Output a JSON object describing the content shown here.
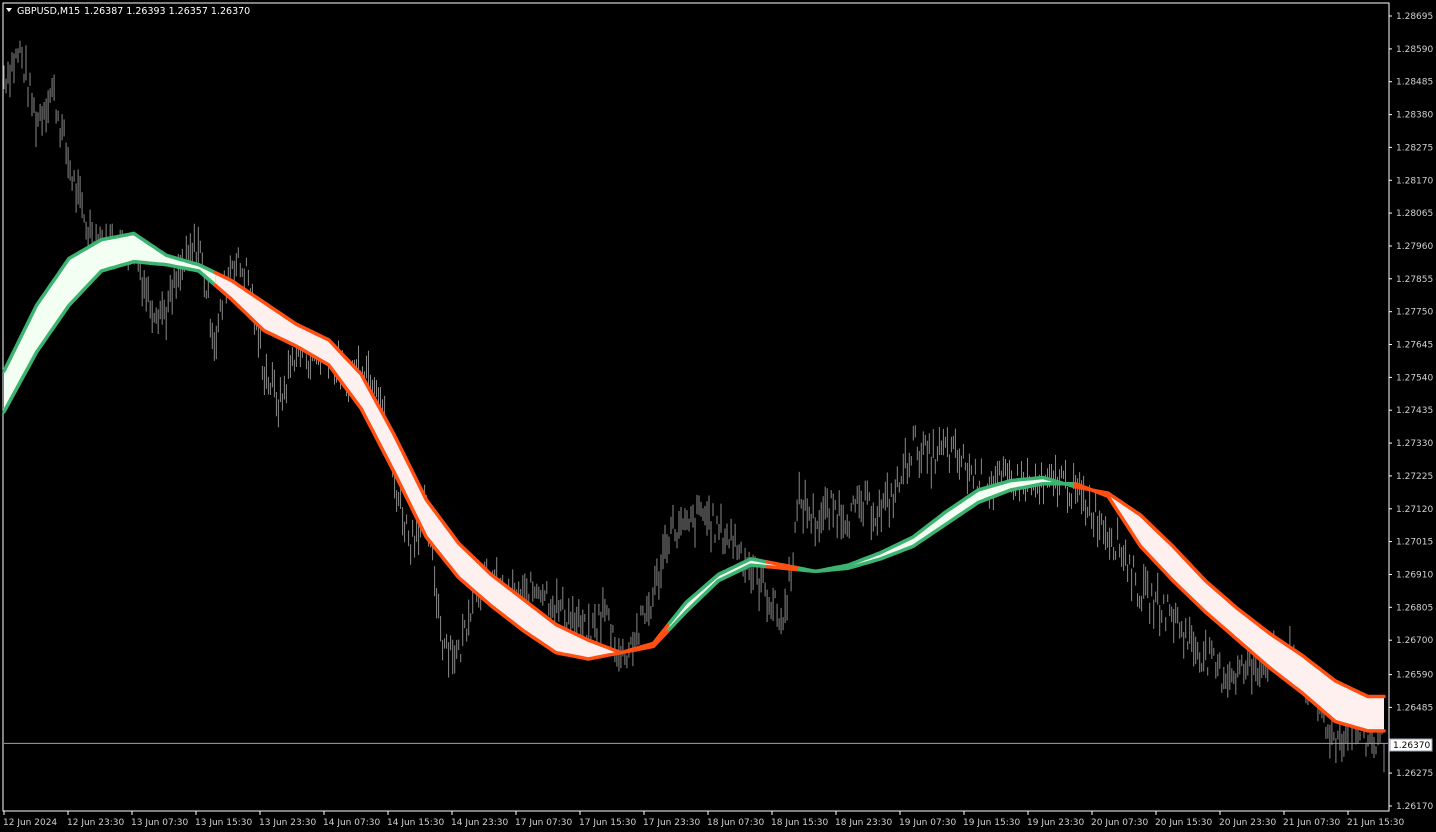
{
  "header": {
    "symbol": "GBPUSD,M15",
    "quote": "1.26387 1.26393 1.26357 1.26370"
  },
  "current_price_label": "1.26370",
  "colors": {
    "background": "#000000",
    "frame": "#ffffff",
    "candles": "#8a8a8a",
    "bull_band_line": "#3cb371",
    "bull_band_fill": "#f3fff3",
    "bear_band_line": "#ff4f12",
    "bear_band_fill": "#fff0f0",
    "price_line": "#9aa4b0"
  },
  "chart_data": {
    "type": "line",
    "symbol": "GBPUSD",
    "timeframe": "M15",
    "ylim": [
      1.2617,
      1.28695
    ],
    "y_ticks": [
      "1.28695",
      "1.28590",
      "1.28485",
      "1.28380",
      "1.28275",
      "1.28170",
      "1.28065",
      "1.27960",
      "1.27855",
      "1.27750",
      "1.27645",
      "1.27540",
      "1.27435",
      "1.27330",
      "1.27225",
      "1.27120",
      "1.27015",
      "1.26910",
      "1.26805",
      "1.26700",
      "1.26590",
      "1.26485",
      "1.26275",
      "1.26170"
    ],
    "x_ticks": [
      "12 Jun 2024",
      "12 Jun 23:30",
      "13 Jun 07:30",
      "13 Jun 15:30",
      "13 Jun 23:30",
      "14 Jun 07:30",
      "14 Jun 15:30",
      "14 Jun 23:30",
      "17 Jun 07:30",
      "17 Jun 15:30",
      "17 Jun 23:30",
      "18 Jun 07:30",
      "18 Jun 15:30",
      "18 Jun 23:30",
      "19 Jun 07:30",
      "19 Jun 15:30",
      "19 Jun 23:30",
      "20 Jun 07:30",
      "20 Jun 15:30",
      "20 Jun 23:30",
      "21 Jun 07:30",
      "21 Jun 15:30"
    ],
    "current_price": 1.2637,
    "price_close_path": [
      [
        0,
        1.285
      ],
      [
        1,
        1.2858
      ],
      [
        2,
        1.2836
      ],
      [
        3,
        1.2846
      ],
      [
        4,
        1.2822
      ],
      [
        5,
        1.2803
      ],
      [
        6,
        1.2797
      ],
      [
        7,
        1.2796
      ],
      [
        8,
        1.2795
      ],
      [
        9,
        1.2778
      ],
      [
        10,
        1.2775
      ],
      [
        11,
        1.2789
      ],
      [
        12,
        1.2797
      ],
      [
        13,
        1.2765
      ],
      [
        14,
        1.2792
      ],
      [
        15,
        1.2787
      ],
      [
        16,
        1.2757
      ],
      [
        17,
        1.2745
      ],
      [
        18,
        1.2764
      ],
      [
        19,
        1.276
      ],
      [
        20,
        1.2762
      ],
      [
        21,
        1.2752
      ],
      [
        22,
        1.2759
      ],
      [
        23,
        1.2754
      ],
      [
        24,
        1.2722
      ],
      [
        25,
        1.2702
      ],
      [
        26,
        1.2711
      ],
      [
        27,
        1.2671
      ],
      [
        28,
        1.2665
      ],
      [
        29,
        1.2688
      ],
      [
        30,
        1.2688
      ],
      [
        31,
        1.2684
      ],
      [
        32,
        1.2683
      ],
      [
        33,
        1.2688
      ],
      [
        34,
        1.2681
      ],
      [
        35,
        1.2677
      ],
      [
        36,
        1.2671
      ],
      [
        37,
        1.268
      ],
      [
        38,
        1.2664
      ],
      [
        39,
        1.2672
      ],
      [
        40,
        1.2684
      ],
      [
        41,
        1.2706
      ],
      [
        42,
        1.2705
      ],
      [
        43,
        1.2711
      ],
      [
        44,
        1.2705
      ],
      [
        45,
        1.2702
      ],
      [
        46,
        1.2693
      ],
      [
        47,
        1.2685
      ],
      [
        48,
        1.2675
      ],
      [
        49,
        1.2715
      ],
      [
        50,
        1.2708
      ],
      [
        51,
        1.2712
      ],
      [
        52,
        1.271
      ],
      [
        53,
        1.2713
      ],
      [
        54,
        1.2711
      ],
      [
        55,
        1.2718
      ],
      [
        56,
        1.2733
      ],
      [
        57,
        1.2728
      ],
      [
        58,
        1.2731
      ],
      [
        59,
        1.2727
      ],
      [
        60,
        1.2721
      ],
      [
        61,
        1.272
      ],
      [
        62,
        1.2721
      ],
      [
        63,
        1.272
      ],
      [
        64,
        1.2718
      ],
      [
        65,
        1.2722
      ],
      [
        66,
        1.2717
      ],
      [
        67,
        1.2712
      ],
      [
        68,
        1.2705
      ],
      [
        69,
        1.2698
      ],
      [
        70,
        1.2685
      ],
      [
        71,
        1.2682
      ],
      [
        72,
        1.2678
      ],
      [
        73,
        1.267
      ],
      [
        74,
        1.2665
      ],
      [
        75,
        1.2659
      ],
      [
        76,
        1.266
      ],
      [
        77,
        1.2662
      ],
      [
        78,
        1.2664
      ],
      [
        79,
        1.2665
      ],
      [
        80,
        1.2661
      ],
      [
        81,
        1.2648
      ],
      [
        82,
        1.2638
      ],
      [
        83,
        1.2643
      ],
      [
        84,
        1.2638
      ],
      [
        85,
        1.2637
      ]
    ],
    "band_upper": [
      [
        0,
        1.2756
      ],
      [
        2,
        1.2777
      ],
      [
        4,
        1.2792
      ],
      [
        6,
        1.2798
      ],
      [
        8,
        1.28
      ],
      [
        10,
        1.2793
      ],
      [
        12,
        1.279
      ],
      [
        14,
        1.2785
      ],
      [
        16,
        1.2778
      ],
      [
        18,
        1.2771
      ],
      [
        20,
        1.2766
      ],
      [
        22,
        1.2755
      ],
      [
        24,
        1.2736
      ],
      [
        26,
        1.2715
      ],
      [
        28,
        1.2701
      ],
      [
        30,
        1.2691
      ],
      [
        32,
        1.2683
      ],
      [
        34,
        1.2675
      ],
      [
        36,
        1.267
      ],
      [
        38,
        1.2666
      ],
      [
        40,
        1.2669
      ],
      [
        42,
        1.2682
      ],
      [
        44,
        1.2691
      ],
      [
        46,
        1.2696
      ],
      [
        48,
        1.2694
      ],
      [
        50,
        1.2692
      ],
      [
        52,
        1.2694
      ],
      [
        54,
        1.2698
      ],
      [
        56,
        1.2703
      ],
      [
        58,
        1.2711
      ],
      [
        60,
        1.2718
      ],
      [
        62,
        1.2721
      ],
      [
        64,
        1.2722
      ],
      [
        66,
        1.2719
      ],
      [
        68,
        1.2717
      ],
      [
        70,
        1.271
      ],
      [
        72,
        1.27
      ],
      [
        74,
        1.2689
      ],
      [
        76,
        1.268
      ],
      [
        78,
        1.2672
      ],
      [
        80,
        1.2665
      ],
      [
        82,
        1.2657
      ],
      [
        84,
        1.2652
      ]
    ],
    "band_lower": [
      [
        0,
        1.2743
      ],
      [
        2,
        1.2762
      ],
      [
        4,
        1.2777
      ],
      [
        6,
        1.2788
      ],
      [
        8,
        1.2791
      ],
      [
        10,
        1.279
      ],
      [
        12,
        1.2788
      ],
      [
        14,
        1.2779
      ],
      [
        16,
        1.2769
      ],
      [
        18,
        1.2764
      ],
      [
        20,
        1.2758
      ],
      [
        22,
        1.2744
      ],
      [
        24,
        1.2724
      ],
      [
        26,
        1.2703
      ],
      [
        28,
        1.269
      ],
      [
        30,
        1.2681
      ],
      [
        32,
        1.2673
      ],
      [
        34,
        1.2666
      ],
      [
        36,
        1.2664
      ],
      [
        38,
        1.2666
      ],
      [
        40,
        1.2668
      ],
      [
        42,
        1.2679
      ],
      [
        44,
        1.2689
      ],
      [
        46,
        1.2694
      ],
      [
        48,
        1.2693
      ],
      [
        50,
        1.2692
      ],
      [
        52,
        1.2693
      ],
      [
        54,
        1.2696
      ],
      [
        56,
        1.27
      ],
      [
        58,
        1.2707
      ],
      [
        60,
        1.2714
      ],
      [
        62,
        1.2718
      ],
      [
        64,
        1.272
      ],
      [
        66,
        1.272
      ],
      [
        68,
        1.2716
      ],
      [
        70,
        1.27
      ],
      [
        72,
        1.2689
      ],
      [
        74,
        1.2679
      ],
      [
        76,
        1.267
      ],
      [
        78,
        1.2661
      ],
      [
        80,
        1.2653
      ],
      [
        82,
        1.2644
      ],
      [
        84,
        1.2641
      ]
    ],
    "band_trend": [
      {
        "from": 0,
        "to": 13,
        "state": "bull"
      },
      {
        "from": 13,
        "to": 41,
        "state": "bear"
      },
      {
        "from": 41,
        "to": 47,
        "state": "bull"
      },
      {
        "from": 47,
        "to": 49,
        "state": "bear"
      },
      {
        "from": 49,
        "to": 66,
        "state": "bull"
      },
      {
        "from": 66,
        "to": 85,
        "state": "bear"
      }
    ]
  }
}
